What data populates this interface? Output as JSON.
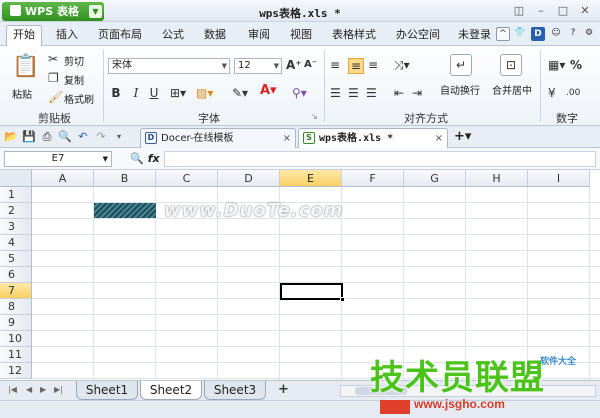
{
  "app": {
    "logo": "WPS 表格",
    "title": "wps表格.xls *"
  },
  "menu_tabs": [
    "开始",
    "插入",
    "页面布局",
    "公式",
    "数据",
    "审阅",
    "视图",
    "表格样式",
    "办公空间",
    "未登录"
  ],
  "ribbon": {
    "paste": "粘贴",
    "cut": "剪切",
    "copy": "复制",
    "format_painter": "格式刷",
    "clipboard_group": "剪贴板",
    "font_name": "宋体",
    "font_size": "12",
    "font_group": "字体",
    "bold": "B",
    "italic": "I",
    "underline": "U",
    "wrap": "自动换行",
    "merge": "合并居中",
    "align_group": "对齐方式",
    "number_group": "数字",
    "percent": "%"
  },
  "doc_tabs": [
    {
      "icon": "D",
      "label": "Docer-在线模板"
    },
    {
      "icon": "S",
      "label": "wps表格.xls *"
    }
  ],
  "formula_bar": {
    "name_box": "E7",
    "fx": "fx",
    "value": ""
  },
  "columns": [
    "A",
    "B",
    "C",
    "D",
    "E",
    "F",
    "G",
    "H",
    "I"
  ],
  "rows": [
    "1",
    "2",
    "3",
    "4",
    "5",
    "6",
    "7",
    "8",
    "9",
    "10",
    "11",
    "12"
  ],
  "selected": {
    "column": "E",
    "row": "7"
  },
  "sheets": [
    "Sheet1",
    "Sheet2",
    "Sheet3"
  ],
  "add_sheet": "+",
  "watermark": "www.DuoTe.com",
  "brand": {
    "name": "技术员联盟",
    "url": "www.jsgho.com",
    "sub": "软件大全"
  }
}
